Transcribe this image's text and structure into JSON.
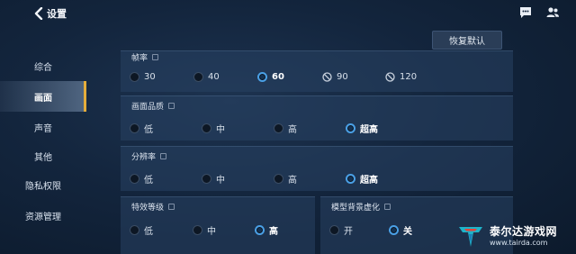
{
  "header": {
    "back_label": "设置"
  },
  "reset_label": "恢复默认",
  "sidebar": {
    "items": [
      {
        "label": "综合"
      },
      {
        "label": "画面",
        "active": true
      },
      {
        "label": "声音"
      },
      {
        "label": "其他"
      },
      {
        "label": "隐私权限"
      },
      {
        "label": "资源管理"
      }
    ]
  },
  "sections": {
    "framerate": {
      "title": "帧率",
      "options": [
        "30",
        "40",
        "60",
        "90",
        "120"
      ],
      "selected": "60",
      "disabled": [
        "90",
        "120"
      ]
    },
    "quality": {
      "title": "画面品质",
      "options": [
        "低",
        "中",
        "高",
        "超高"
      ],
      "selected": "超高"
    },
    "resolution": {
      "title": "分辨率",
      "options": [
        "低",
        "中",
        "高",
        "超高"
      ],
      "selected": "超高"
    },
    "effects": {
      "title": "特效等级",
      "options": [
        "低",
        "中",
        "高"
      ],
      "selected": "高"
    },
    "blur": {
      "title": "模型背景虚化",
      "options": [
        "开",
        "关"
      ],
      "selected": "关"
    }
  },
  "watermark": {
    "name": "泰尔达游戏网",
    "url": "www.tairda.com"
  },
  "colors": {
    "accent": "#4aa0e6",
    "active_marker": "#e5ad3b",
    "background": "#13253d"
  }
}
